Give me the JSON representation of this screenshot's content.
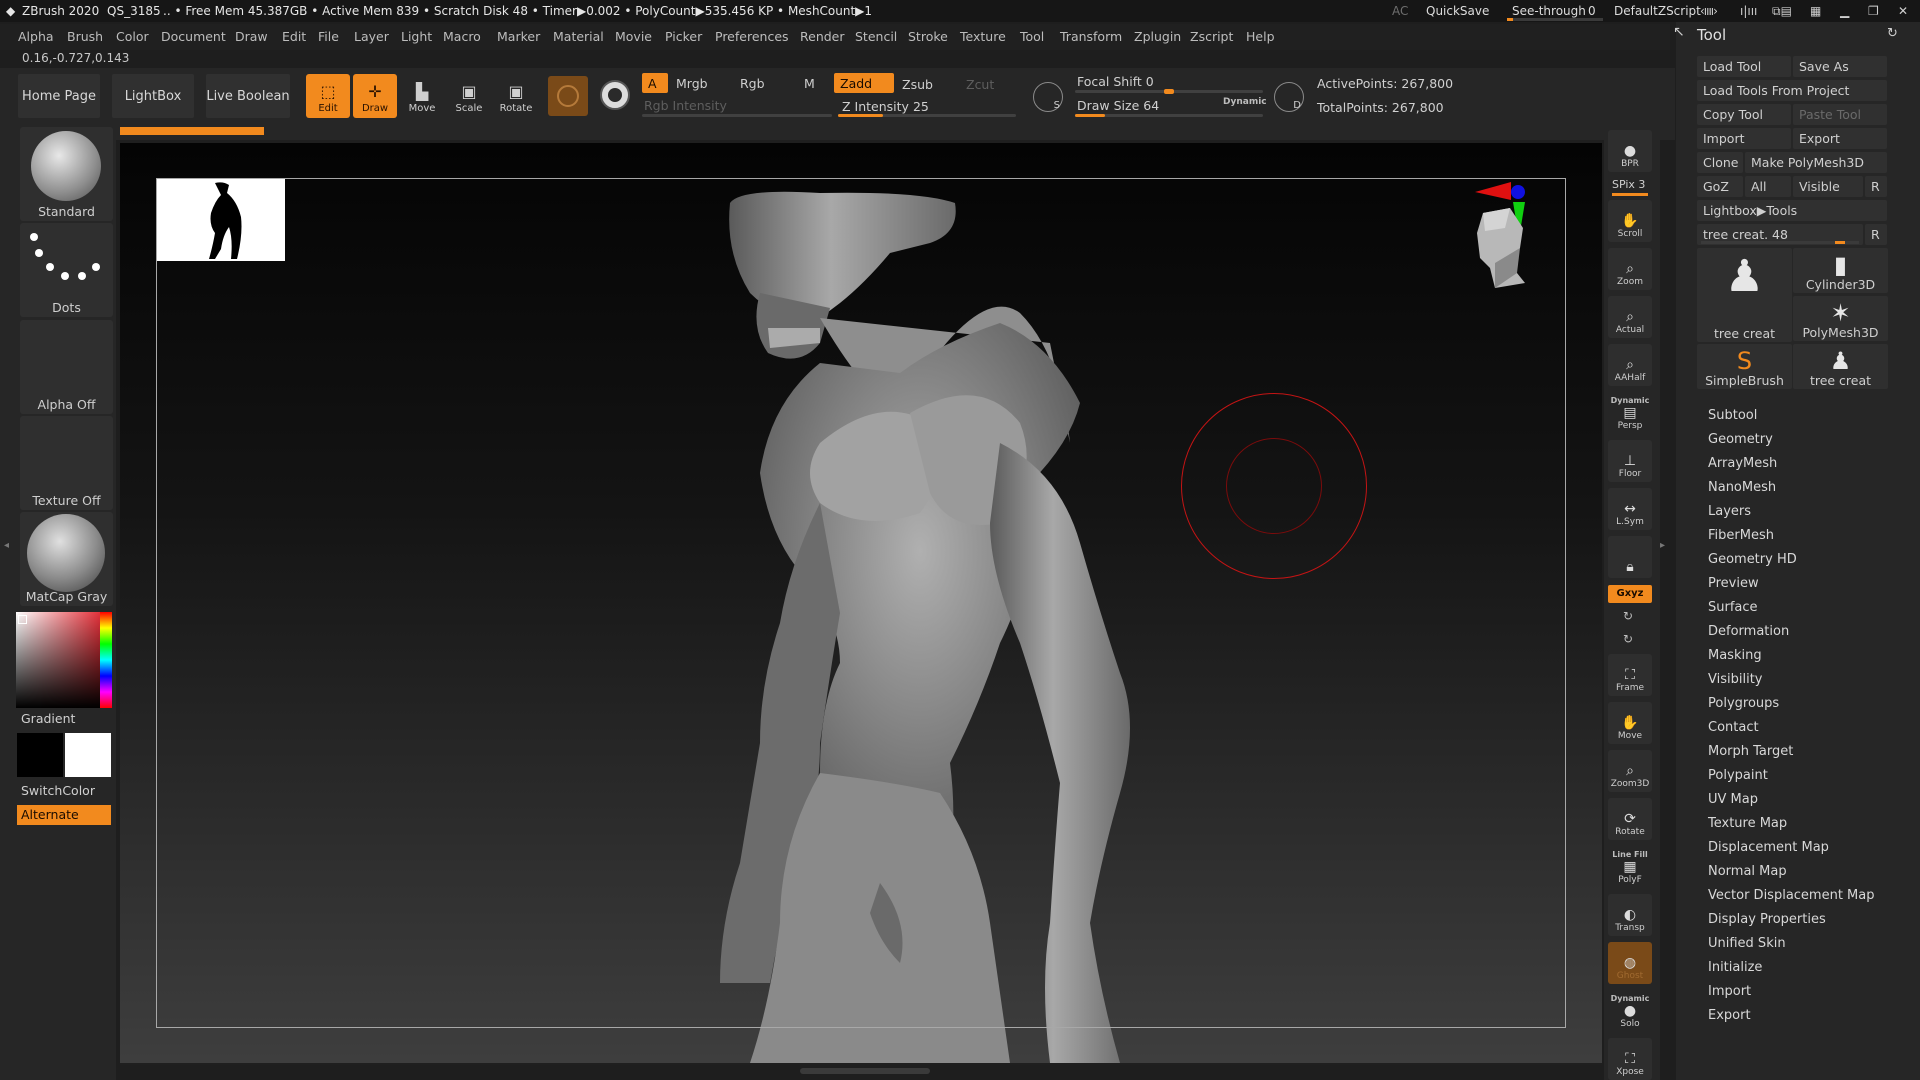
{
  "titlebar": {
    "app": "ZBrush 2020",
    "doc": "QS_3185",
    "stats": ".. • Free Mem 45.387GB • Active Mem 839 • Scratch Disk 48 • Timer▶0.002 • PolyCount▶535.456 KP • MeshCount▶1",
    "ac": "AC",
    "quicksave": "QuickSave",
    "seethrough": "See-through",
    "seethrough_value": "0",
    "script": "DefaultZScript"
  },
  "menu": [
    "Alpha",
    "Brush",
    "Color",
    "Document",
    "Draw",
    "Edit",
    "File",
    "Layer",
    "Light",
    "Macro",
    "Marker",
    "Material",
    "Movie",
    "Picker",
    "Preferences",
    "Render",
    "Stencil",
    "Stroke",
    "Texture",
    "Tool",
    "Transform",
    "Zplugin",
    "Zscript",
    "Help"
  ],
  "coords": "0.16,-0.727,0.143",
  "nav": {
    "home": "Home Page",
    "lightbox": "LightBox",
    "liveboolean": "Live Boolean"
  },
  "tools": {
    "edit": "Edit",
    "draw": "Draw",
    "move": "Move",
    "scale": "Scale",
    "rotate": "Rotate"
  },
  "color_mode": {
    "a": "A",
    "mrgb": "Mrgb",
    "rgb": "Rgb",
    "m": "M",
    "rgb_intensity": "Rgb Intensity"
  },
  "sculpt_mode": {
    "zadd": "Zadd",
    "zsub": "Zsub",
    "zcut": "Zcut",
    "z_intensity_label": "Z Intensity",
    "z_intensity": "25",
    "z_intensity_level": 0.25
  },
  "brush_settings": {
    "focal_label": "Focal Shift",
    "focal_value": "0",
    "focal_level": 0.5,
    "drawsize_label": "Draw Size",
    "drawsize_value": "64",
    "drawsize_level": 0.16,
    "dynamic": "Dynamic"
  },
  "points": {
    "active": "ActivePoints: 267,800",
    "total": "TotalPoints: 267,800"
  },
  "left": {
    "brush": "Standard",
    "stroke": "Dots",
    "alpha": "Alpha Off",
    "texture": "Texture Off",
    "material": "MatCap Gray",
    "gradient": "Gradient",
    "switchcolor": "SwitchColor",
    "alternate": "Alternate",
    "primary_color": "#000000",
    "secondary_color": "#ffffff"
  },
  "right_shelf": {
    "bpr": "BPR",
    "spix": "SPix 3",
    "scroll": "Scroll",
    "zoom": "Zoom",
    "actual": "Actual",
    "aahalf": "AAHalf",
    "dynamic": "Dynamic",
    "persp": "Persp",
    "floor": "Floor",
    "lsym": "L.Sym",
    "xyz": "Gxyz",
    "frame": "Frame",
    "move": "Move",
    "zoom3d": "Zoom3D",
    "rotate": "Rotate",
    "linefill": "Line Fill",
    "polyf": "PolyF",
    "transp": "Transp",
    "ghost": "Ghost",
    "solo_dyn": "Dynamic",
    "solo": "Solo",
    "xpose": "Xpose"
  },
  "tool_panel": {
    "title": "Tool",
    "load_tool": "Load Tool",
    "save_as": "Save As",
    "load_from_project": "Load Tools From Project",
    "copy_tool": "Copy Tool",
    "paste_tool": "Paste Tool",
    "import": "Import",
    "export": "Export",
    "clone": "Clone",
    "make_polymesh": "Make PolyMesh3D",
    "goz": "GoZ",
    "all": "All",
    "visible": "Visible",
    "r": "R",
    "lightbox_tools": "Lightbox▶Tools",
    "current_tool": "tree creat. 48",
    "thumbs": [
      "tree creat",
      "Cylinder3D",
      "PolyMesh3D",
      "SimpleBrush",
      "tree creat"
    ],
    "sections": [
      "Subtool",
      "Geometry",
      "ArrayMesh",
      "NanoMesh",
      "Layers",
      "FiberMesh",
      "Geometry HD",
      "Preview",
      "Surface",
      "Deformation",
      "Masking",
      "Visibility",
      "Polygroups",
      "Contact",
      "Morph Target",
      "Polypaint",
      "UV Map",
      "Texture Map",
      "Displacement Map",
      "Normal Map",
      "Vector Displacement Map",
      "Display Properties",
      "Unified Skin",
      "Initialize",
      "Import",
      "Export"
    ]
  },
  "accent": "#f28a1e"
}
